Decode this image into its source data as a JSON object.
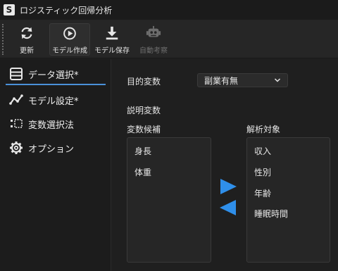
{
  "app": {
    "icon_letter": "S",
    "title": "ロジスティック回帰分析"
  },
  "toolbar": {
    "buttons": [
      {
        "label": "更新",
        "icon": "refresh-icon",
        "enabled": true
      },
      {
        "label": "モデル作成",
        "icon": "play-circle-icon",
        "enabled": true
      },
      {
        "label": "モデル保存",
        "icon": "download-icon",
        "enabled": true
      },
      {
        "label": "自動考察",
        "icon": "robot-icon",
        "enabled": false
      }
    ]
  },
  "sidebar": {
    "items": [
      {
        "label": "データ選択*",
        "icon": "table-icon",
        "active": true
      },
      {
        "label": "モデル設定*",
        "icon": "line-chart-icon",
        "active": false
      },
      {
        "label": "変数選択法",
        "icon": "selection-list-icon",
        "active": false
      },
      {
        "label": "オプション",
        "icon": "gear-icon",
        "active": false
      }
    ]
  },
  "main": {
    "target_label": "目的変数",
    "target_value": "副業有無",
    "explanatory_label": "説明変数",
    "candidates_label": "変数候補",
    "selected_label": "解析対象",
    "candidates": [
      "身長",
      "体重"
    ],
    "selected": [
      "収入",
      "性別",
      "年齢",
      "睡眠時間"
    ]
  },
  "colors": {
    "accent": "#2f8fea",
    "active_underline": "#4a90d9",
    "background": "#1f1f1f"
  }
}
